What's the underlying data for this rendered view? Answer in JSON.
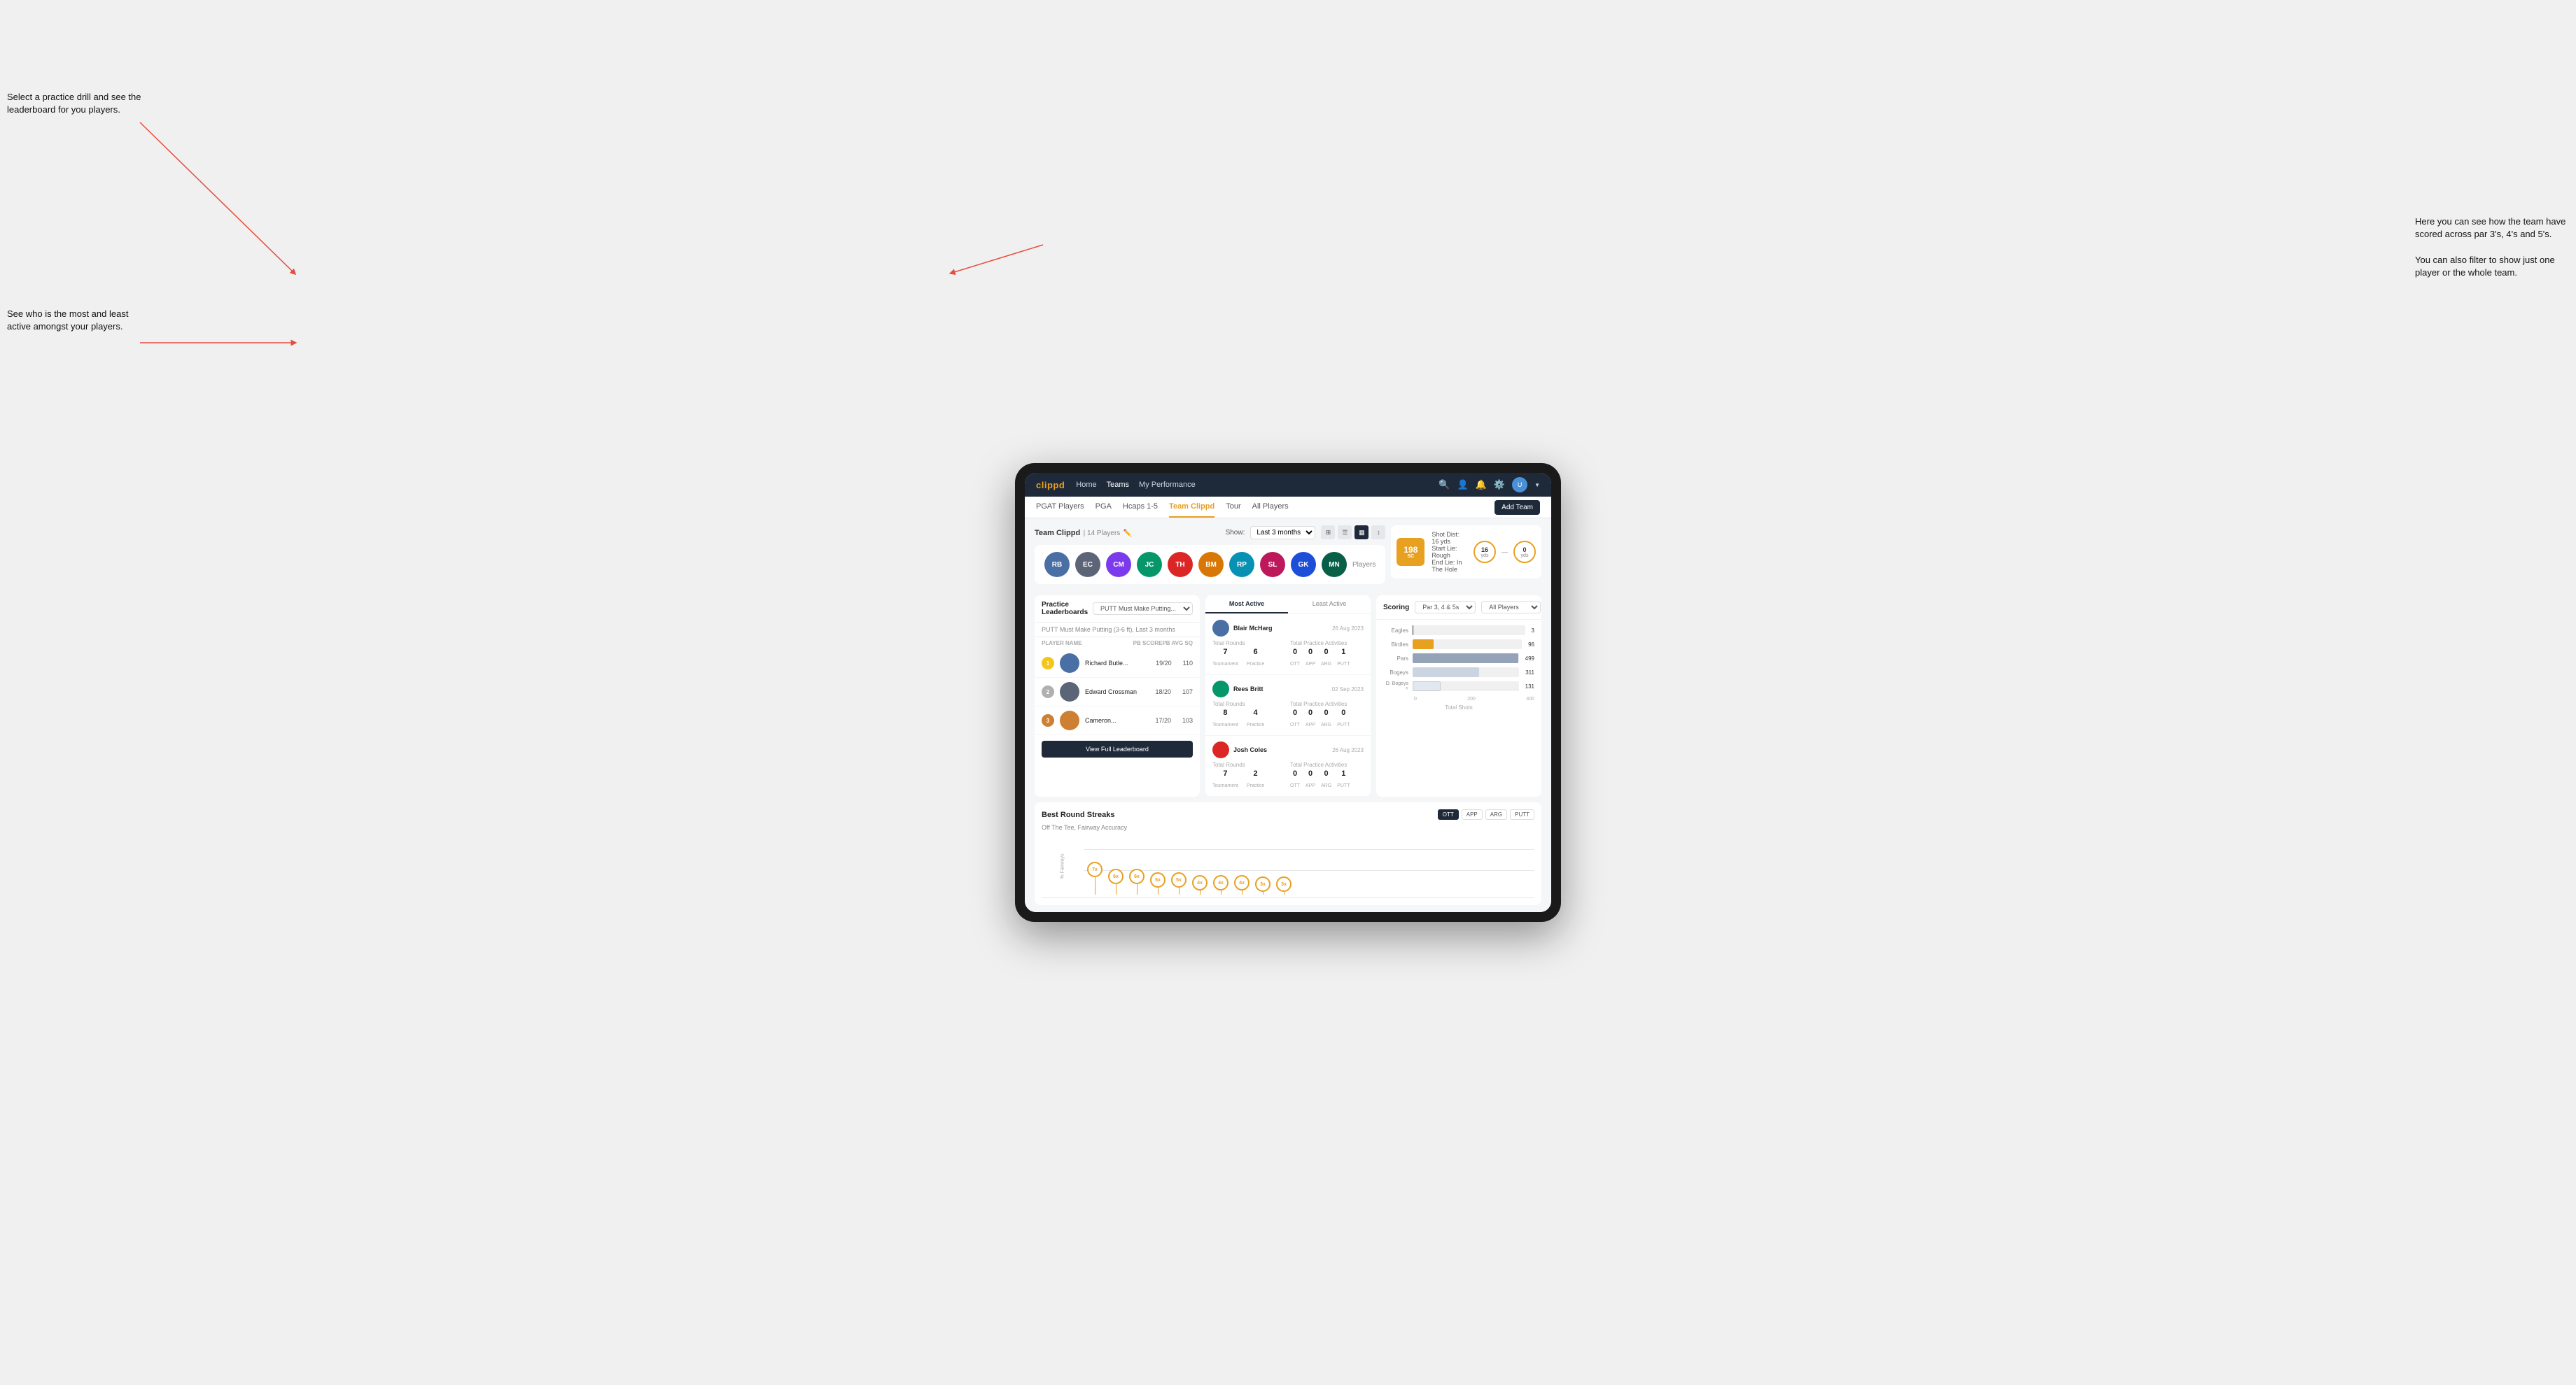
{
  "annotations": {
    "top_left": "Select a practice drill and see the leaderboard for you players.",
    "bottom_left": "See who is the most and least active amongst your players.",
    "top_right": "Here you can see how the team have scored across par 3's, 4's and 5's.\n\nYou can also filter to show just one player or the whole team."
  },
  "nav": {
    "logo": "clippd",
    "items": [
      "Home",
      "Teams",
      "My Performance"
    ],
    "icons": [
      "search",
      "person",
      "bell",
      "settings",
      "avatar"
    ],
    "active": "Teams"
  },
  "sub_nav": {
    "items": [
      "PGAT Players",
      "PGA",
      "Hcaps 1-5",
      "Team Clippd",
      "Tour",
      "All Players"
    ],
    "active": "Team Clippd",
    "add_team_label": "Add Team"
  },
  "team_header": {
    "title": "Team Clippd",
    "player_count": "14 Players",
    "show_label": "Show:",
    "period": "Last 3 months"
  },
  "players": [
    {
      "initials": "RB",
      "color": "#4a6fa5"
    },
    {
      "initials": "EC",
      "color": "#6b7280"
    },
    {
      "initials": "CM",
      "color": "#7c3aed"
    },
    {
      "initials": "JC",
      "color": "#059669"
    },
    {
      "initials": "TH",
      "color": "#dc2626"
    },
    {
      "initials": "BM",
      "color": "#d97706"
    },
    {
      "initials": "RP",
      "color": "#0891b2"
    },
    {
      "initials": "SL",
      "color": "#be185d"
    },
    {
      "initials": "GK",
      "color": "#1d4ed8"
    },
    {
      "initials": "MN",
      "color": "#065f46"
    }
  ],
  "players_label": "Players",
  "shot_card": {
    "badge": "198",
    "badge_sub": "SC",
    "info_line1": "Shot Dist: 16 yds",
    "info_line2": "Start Lie: Rough",
    "info_line3": "End Lie: In The Hole",
    "dist1": "16",
    "dist1_unit": "yds",
    "dist2": "0",
    "dist2_unit": "yds"
  },
  "leaderboard": {
    "title": "Practice Leaderboards",
    "dropdown": "PUTT Must Make Putting...",
    "subtitle": "PUTT Must Make Putting (3-6 ft), Last 3 months",
    "columns": [
      "PLAYER NAME",
      "PB SCORE",
      "PB AVG SQ"
    ],
    "players": [
      {
        "rank": 1,
        "name": "Richard Butle...",
        "score": "19/20",
        "avg": "110",
        "medal": "gold"
      },
      {
        "rank": 2,
        "name": "Edward Crossman",
        "score": "18/20",
        "avg": "107",
        "medal": "silver"
      },
      {
        "rank": 3,
        "name": "Cameron...",
        "score": "17/20",
        "avg": "103",
        "medal": "bronze"
      }
    ],
    "view_full_label": "View Full Leaderboard"
  },
  "activity": {
    "tabs": [
      "Most Active",
      "Least Active"
    ],
    "active_tab": "Most Active",
    "players": [
      {
        "name": "Blair McHarg",
        "date": "26 Aug 2023",
        "total_rounds_label": "Total Rounds",
        "tournament": "7",
        "practice": "6",
        "total_practice_label": "Total Practice Activities",
        "ott": "0",
        "app": "0",
        "arg": "0",
        "putt": "1"
      },
      {
        "name": "Rees Britt",
        "date": "02 Sep 2023",
        "total_rounds_label": "Total Rounds",
        "tournament": "8",
        "practice": "4",
        "total_practice_label": "Total Practice Activities",
        "ott": "0",
        "app": "0",
        "arg": "0",
        "putt": "0"
      },
      {
        "name": "Josh Coles",
        "date": "26 Aug 2023",
        "total_rounds_label": "Total Rounds",
        "tournament": "7",
        "practice": "2",
        "total_practice_label": "Total Practice Activities",
        "ott": "0",
        "app": "0",
        "arg": "0",
        "putt": "1"
      }
    ]
  },
  "scoring": {
    "title": "Scoring",
    "filter": "Par 3, 4 & 5s",
    "player_filter": "All Players",
    "bars": [
      {
        "label": "Eagles",
        "value": 3,
        "max": 500,
        "class": "eagles",
        "display": "3"
      },
      {
        "label": "Birdies",
        "value": 96,
        "max": 500,
        "class": "birdies",
        "display": "96"
      },
      {
        "label": "Pars",
        "value": 499,
        "max": 500,
        "class": "pars",
        "display": "499"
      },
      {
        "label": "Bogeys",
        "value": 311,
        "max": 500,
        "class": "bogeys",
        "display": "311"
      },
      {
        "label": "D. Bogeys +",
        "value": 131,
        "max": 500,
        "class": "dbogeys",
        "display": "131"
      }
    ],
    "axis_labels": [
      "0",
      "200",
      "400"
    ],
    "x_label": "Total Shots"
  },
  "streaks": {
    "title": "Best Round Streaks",
    "filters": [
      "OTT",
      "APP",
      "ARG",
      "PUTT"
    ],
    "active_filter": "OTT",
    "subtitle": "Off The Tee, Fairway Accuracy",
    "points": [
      {
        "x": 5,
        "label": "7x"
      },
      {
        "x": 12,
        "label": "6x"
      },
      {
        "x": 19,
        "label": "6x"
      },
      {
        "x": 27,
        "label": "5x"
      },
      {
        "x": 35,
        "label": "5x"
      },
      {
        "x": 43,
        "label": "4x"
      },
      {
        "x": 52,
        "label": "4x"
      },
      {
        "x": 61,
        "label": "4x"
      },
      {
        "x": 69,
        "label": "3x"
      },
      {
        "x": 78,
        "label": "3x"
      }
    ]
  }
}
